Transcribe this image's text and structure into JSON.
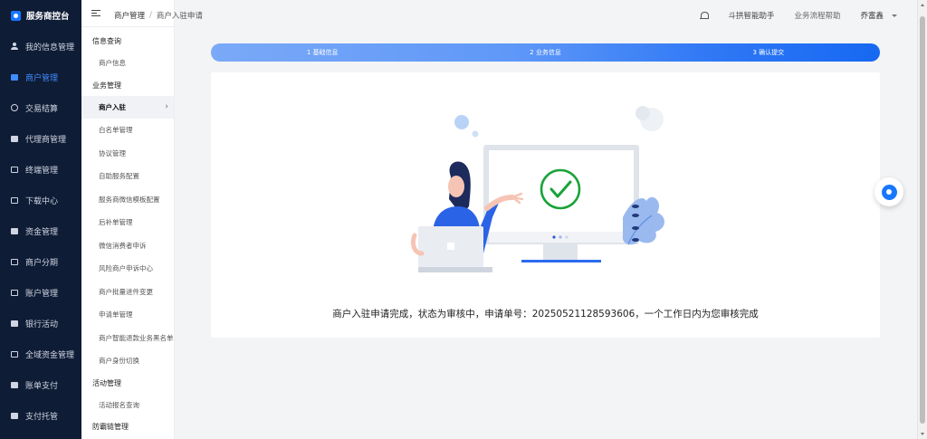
{
  "brand": {
    "title": "服务商控台"
  },
  "sidebar": {
    "items": [
      {
        "label": "我的信息管理",
        "icon": "user-icon",
        "active": false
      },
      {
        "label": "商户管理",
        "icon": "merchant-icon",
        "active": true
      },
      {
        "label": "交易结算",
        "icon": "settlement-icon",
        "active": false
      },
      {
        "label": "代理商管理",
        "icon": "agent-icon",
        "active": false
      },
      {
        "label": "终端管理",
        "icon": "terminal-icon",
        "active": false
      },
      {
        "label": "下载中心",
        "icon": "download-icon",
        "active": false
      },
      {
        "label": "资金管理",
        "icon": "fund-icon",
        "active": false
      },
      {
        "label": "商户分期",
        "icon": "installment-icon",
        "active": false
      },
      {
        "label": "账户管理",
        "icon": "account-icon",
        "active": false
      },
      {
        "label": "银行活动",
        "icon": "gift-icon",
        "active": false
      },
      {
        "label": "全域资金管理",
        "icon": "global-fund-icon",
        "active": false
      },
      {
        "label": "账单支付",
        "icon": "bill-icon",
        "active": false
      },
      {
        "label": "支付托管",
        "icon": "custody-icon",
        "active": false
      }
    ]
  },
  "submenu": {
    "groups": [
      {
        "title": "信息查询",
        "items": [
          {
            "label": "商户信息",
            "active": false
          }
        ]
      },
      {
        "title": "业务管理",
        "items": [
          {
            "label": "商户入驻",
            "active": true
          },
          {
            "label": "白名单管理",
            "active": false
          },
          {
            "label": "协议管理",
            "active": false
          },
          {
            "label": "自助服务配置",
            "active": false
          },
          {
            "label": "服务商微信模板配置",
            "active": false
          },
          {
            "label": "后补单管理",
            "active": false
          },
          {
            "label": "微信消费者申诉",
            "active": false
          },
          {
            "label": "风险商户申诉中心",
            "active": false
          },
          {
            "label": "商户批量进件变更",
            "active": false
          },
          {
            "label": "申请单管理",
            "active": false
          },
          {
            "label": "商户智能退款业务黑名单",
            "active": false
          },
          {
            "label": "商户身份切换",
            "active": false
          }
        ]
      },
      {
        "title": "活动管理",
        "items": [
          {
            "label": "活动报名查询",
            "active": false
          }
        ]
      },
      {
        "title": "防霸链管理",
        "items": []
      }
    ]
  },
  "breadcrumb": {
    "parent": "商户管理",
    "separator": "/",
    "current": "商户入驻申请"
  },
  "header": {
    "assistant": "斗拱智能助手",
    "help": "业务流程帮助",
    "user": "乔富鑫"
  },
  "steps": [
    "1 基础信息",
    "2 业务信息",
    "3 确认提交"
  ],
  "result": {
    "message": "商户入驻申请完成，状态为审核中，申请单号：20250521128593606，一个工作日内为您审核完成"
  },
  "colors": {
    "sidebar_bg": "#0f1c35",
    "accent": "#1677ff",
    "success": "#1aa33a"
  }
}
